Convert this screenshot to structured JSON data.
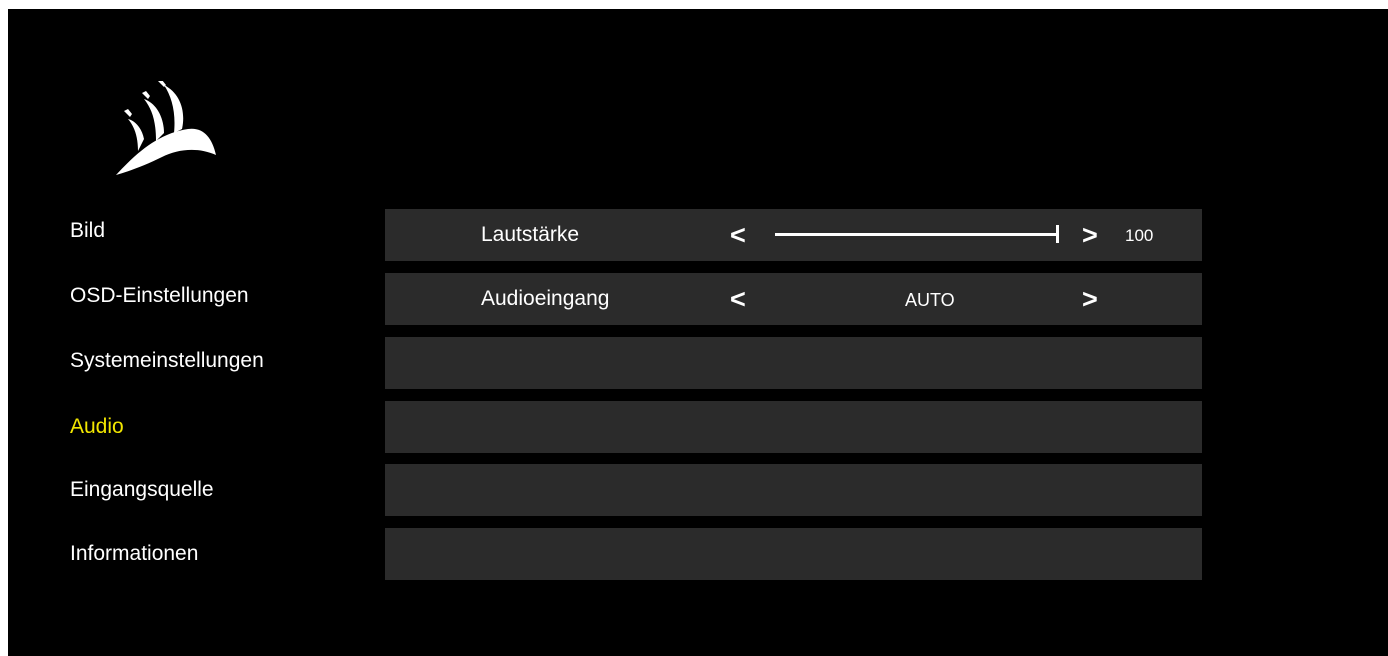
{
  "sidebar": {
    "items": [
      {
        "label": "Bild",
        "active": false
      },
      {
        "label": "OSD-Einstellungen",
        "active": false
      },
      {
        "label": "Systemeinstellungen",
        "active": false
      },
      {
        "label": "Audio",
        "active": true
      },
      {
        "label": "Eingangsquelle",
        "active": false
      },
      {
        "label": "Informationen",
        "active": false
      }
    ]
  },
  "audio": {
    "volume": {
      "label": "Lautstärke",
      "value": "100",
      "level_percent": 100,
      "prev_symbol": "<",
      "next_symbol": ">"
    },
    "input": {
      "label": "Audioeingang",
      "value": "AUTO",
      "prev_symbol": "<",
      "next_symbol": ">"
    }
  },
  "colors": {
    "background": "#000000",
    "row_background": "#2b2b2b",
    "active_item": "#f2e600",
    "text": "#ffffff"
  },
  "icons": {
    "logo": "corsair-sails-logo-icon"
  }
}
